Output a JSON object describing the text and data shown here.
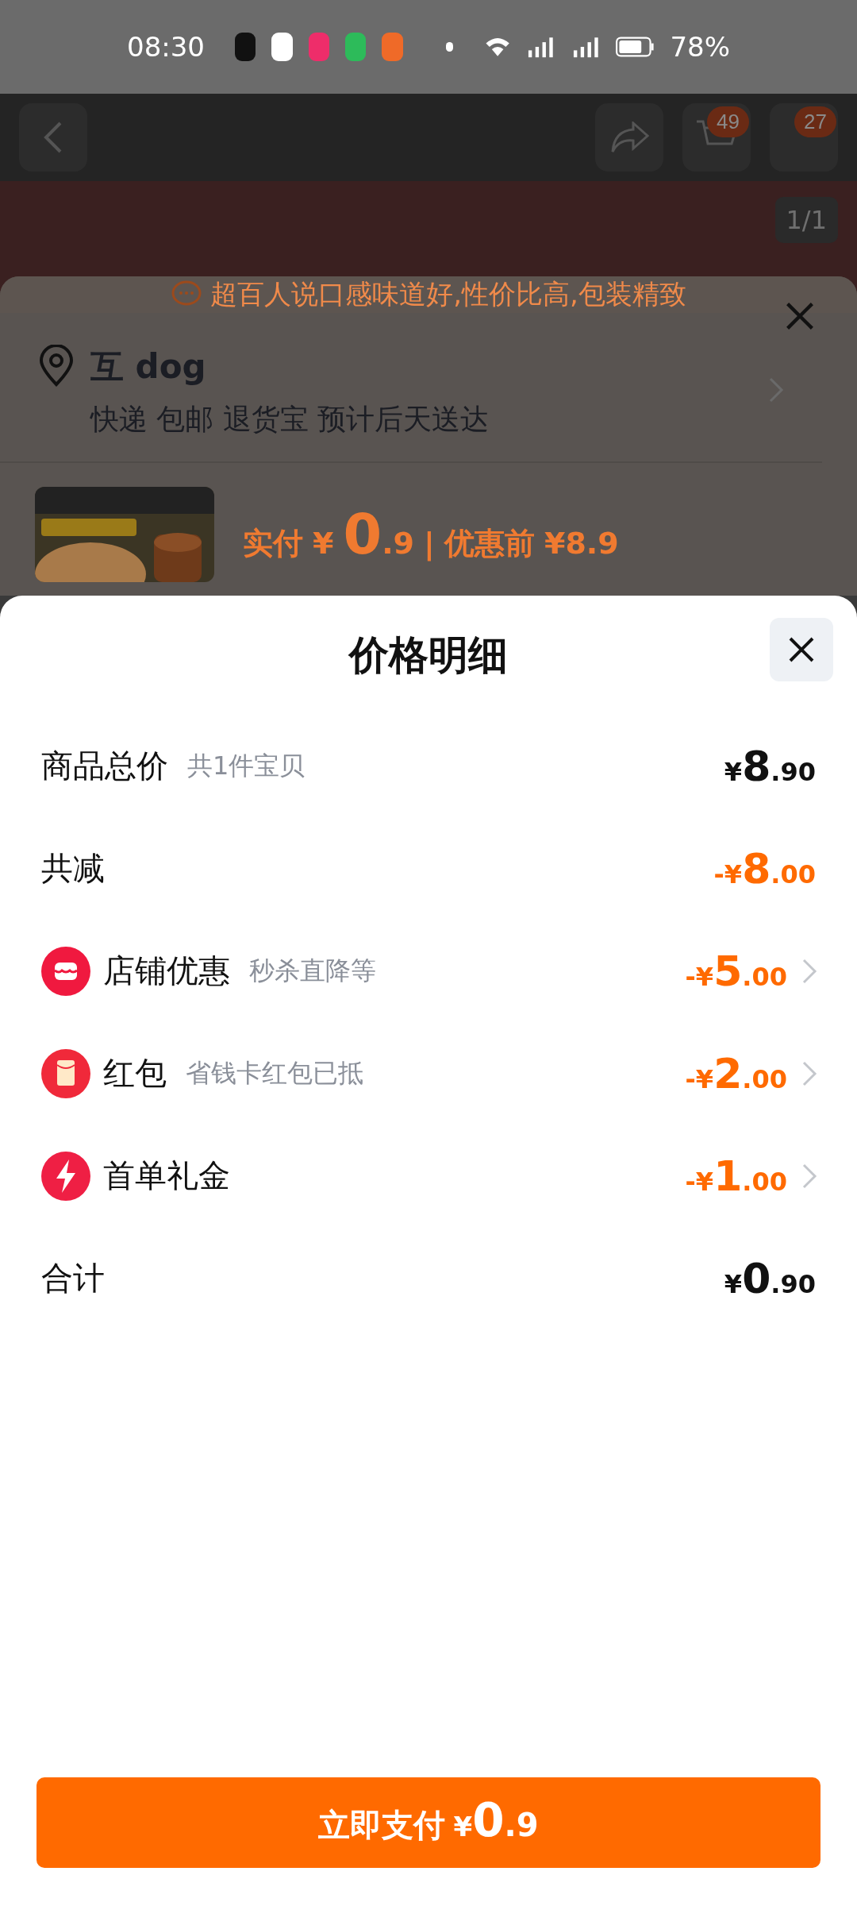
{
  "status_bar": {
    "time": "08:30",
    "battery_text": "78%"
  },
  "background_page": {
    "cart_badge": "49",
    "message_badge": "27",
    "image_counter": "1/1",
    "banner": {
      "text": "超百人说口感味道好,性价比高,包装精致"
    },
    "address": {
      "name": "互 dog",
      "delivery": "快递 包邮 退货宝 预计后天送达"
    },
    "price": {
      "paid_label": "实付",
      "currency": "¥",
      "paid_whole": "0",
      "paid_fraction": ".9",
      "separator": "|",
      "before_label": "优惠前",
      "before_amount": "¥8.9"
    }
  },
  "sheet": {
    "title": "价格明细",
    "rows": [
      {
        "kind": "plain",
        "label": "商品总价",
        "note": "共1件宝贝",
        "sign": "",
        "currency": "¥",
        "whole": "8",
        "fraction": ".90",
        "discount": false
      },
      {
        "kind": "plain",
        "label": "共减",
        "sign": "-",
        "currency": "¥",
        "whole": "8",
        "fraction": ".00",
        "discount": true
      },
      {
        "kind": "store",
        "label": "店铺优惠",
        "note": "秒杀直降等",
        "sign": "-",
        "currency": "¥",
        "whole": "5",
        "fraction": ".00",
        "discount": true
      },
      {
        "kind": "packet",
        "label": "红包",
        "note": "省钱卡红包已抵",
        "sign": "-",
        "currency": "¥",
        "whole": "2",
        "fraction": ".00",
        "discount": true
      },
      {
        "kind": "bolt",
        "label": "首单礼金",
        "sign": "-",
        "currency": "¥",
        "whole": "1",
        "fraction": ".00",
        "discount": true
      },
      {
        "kind": "plain",
        "label": "合计",
        "sign": "",
        "currency": "¥",
        "whole": "0",
        "fraction": ".90",
        "discount": false
      }
    ],
    "pay_button": {
      "label": "立即支付",
      "currency": "¥",
      "whole": "0",
      "fraction": ".9"
    }
  }
}
